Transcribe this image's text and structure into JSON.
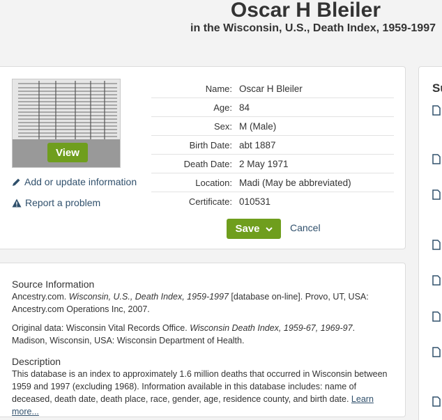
{
  "header": {
    "title": "Oscar H Bleiler",
    "subtitle": "in the Wisconsin, U.S., Death Index, 1959-1997"
  },
  "record": {
    "view_label": "View",
    "add_update_label": "Add or update information",
    "report_label": "Report a problem",
    "facts": [
      {
        "label": "Name:",
        "value": "Oscar H Bleiler"
      },
      {
        "label": "Age:",
        "value": "84"
      },
      {
        "label": "Sex:",
        "value": "M (Male)"
      },
      {
        "label": "Birth Date:",
        "value": "abt 1887"
      },
      {
        "label": "Death Date:",
        "value": "2 May 1971"
      },
      {
        "label": "Location:",
        "value": "Madi (May be abbreviated)"
      },
      {
        "label": "Certificate:",
        "value": "010531"
      }
    ],
    "save_label": "Save",
    "cancel_label": "Cancel"
  },
  "source": {
    "heading": "Source Information",
    "citation_prefix": "Ancestry.com. ",
    "citation_title": "Wisconsin, U.S., Death Index, 1959-1997",
    "citation_suffix": " [database on-line]. Provo, UT, USA: Ancestry.com Operations Inc, 2007.",
    "original_prefix": "Original data: Wisconsin Vital Records Office. ",
    "original_title": "Wisconsin Death Index, 1959-67, 1969-97",
    "original_suffix": ". Madison, Wisconsin, USA: Wisconsin Department of Health.",
    "description_heading": "Description",
    "description_text": "This database is an index to approximately 1.6 million deaths that occurred in Wisconsin between 1959 and 1997 (excluding 1968). Information available in this database includes: name of deceased, death date, death place, race, gender, age, residence county, and birth date. ",
    "learn_more": "Learn more..."
  },
  "sidebar": {
    "title": "Su"
  },
  "colors": {
    "accent_green": "#6f9e1d",
    "link_blue": "#30506c",
    "background": "#f3f3f3"
  }
}
